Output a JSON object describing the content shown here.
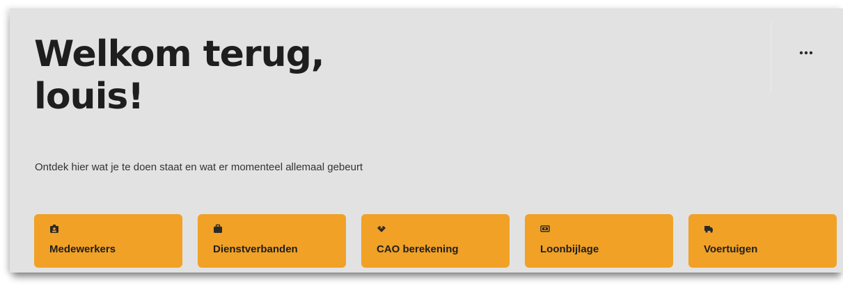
{
  "header": {
    "title_line1": "Welkom terug,",
    "title_line2": "louis!",
    "subtitle": "Ontdek hier wat je te doen staat en wat er momenteel allemaal gebeurt",
    "more_icon": "more-horizontal-icon"
  },
  "tiles": [
    {
      "label": "Medewerkers",
      "icon": "user-badge-icon"
    },
    {
      "label": "Dienstverbanden",
      "icon": "briefcase-icon"
    },
    {
      "label": "CAO berekening",
      "icon": "handshake-icon"
    },
    {
      "label": "Loonbijlage",
      "icon": "money-bill-icon"
    },
    {
      "label": "Voertuigen",
      "icon": "truck-icon"
    }
  ],
  "colors": {
    "background": "#e2e2e2",
    "tile": "#f0a126",
    "text": "#1e1e1e"
  }
}
